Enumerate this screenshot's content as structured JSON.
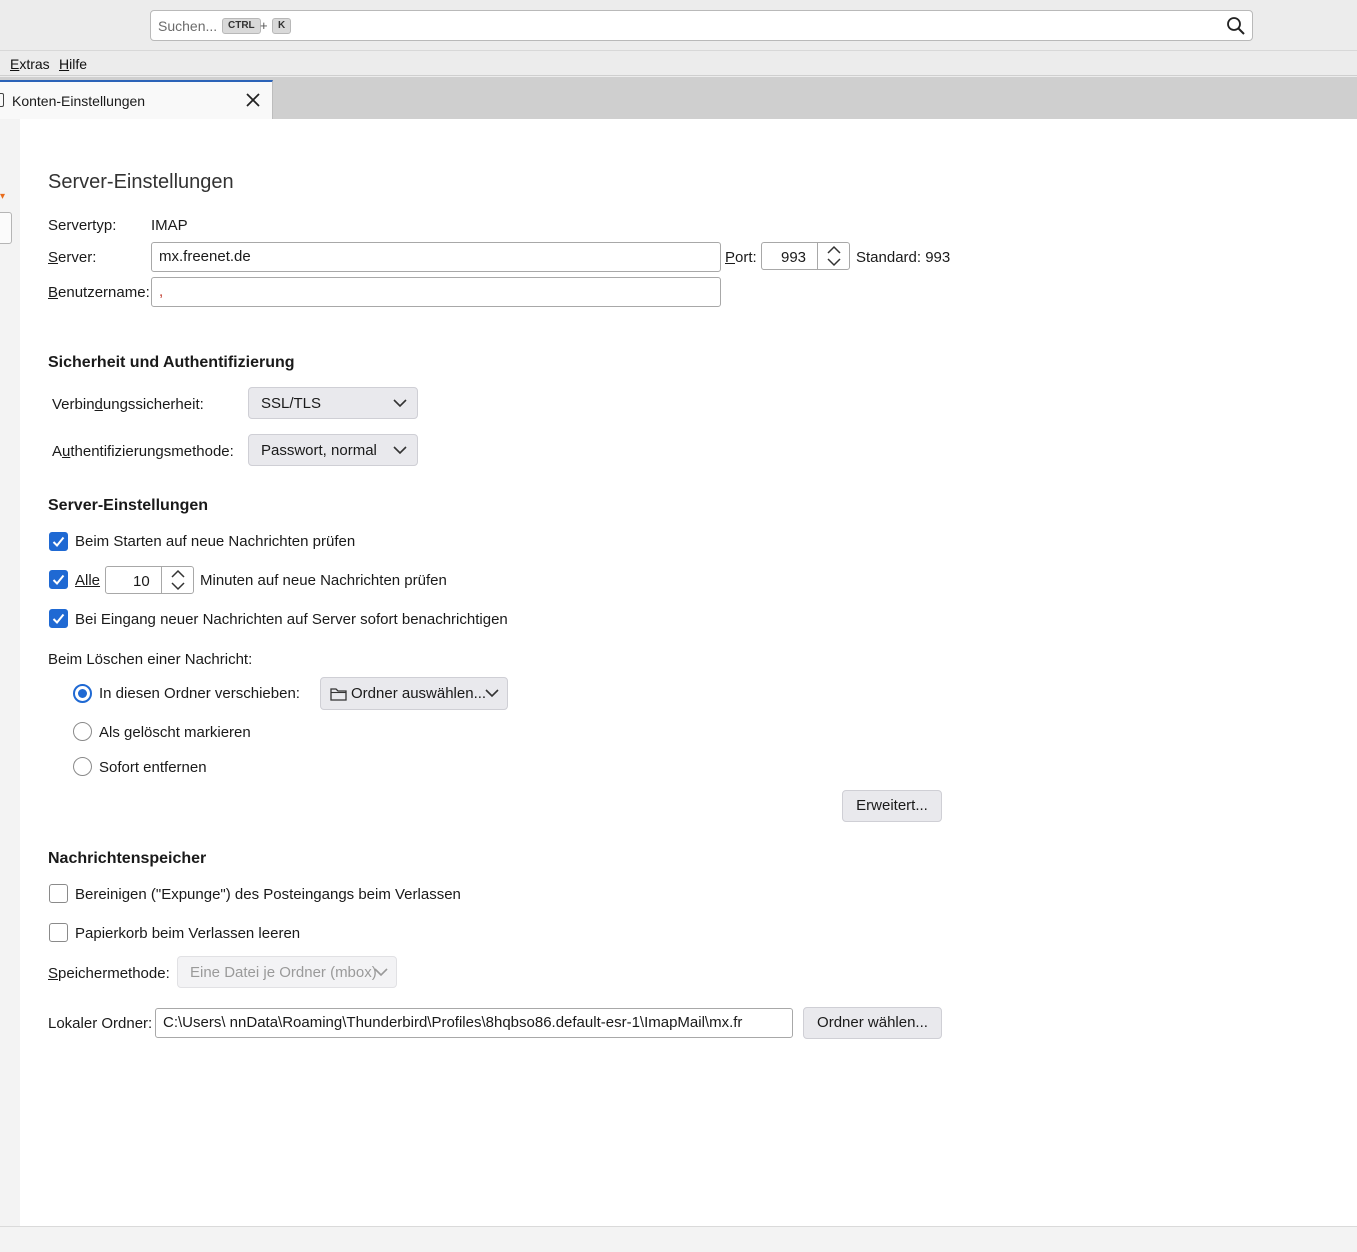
{
  "search": {
    "placeholder": "Suchen...",
    "shortcut_key1": "CTRL",
    "shortcut_plus": "+",
    "shortcut_key2": "K"
  },
  "menu": {
    "extras": "Extras",
    "hilfe": "Hilfe"
  },
  "tab": {
    "label": "Konten-Einstellungen"
  },
  "page": {
    "title": "Server-Einstellungen"
  },
  "server": {
    "type_label": "Servertyp:",
    "type_value": "IMAP",
    "server_label": "Server:",
    "server_value": "mx.freenet.de",
    "port_label": "Port:",
    "port_value": "993",
    "standard_label": "Standard: 993",
    "username_label": "Benutzername:",
    "username_value": ","
  },
  "security": {
    "heading": "Sicherheit und Authentifizierung",
    "connection_label": "Verbindungssicherheit:",
    "connection_value": "SSL/TLS",
    "auth_label": "Authentifizierungsmethode:",
    "auth_value": "Passwort, normal"
  },
  "server_settings": {
    "heading": "Server-Einstellungen",
    "check_on_start": "Beim Starten auf neue Nachrichten prüfen",
    "every_label": "Alle",
    "every_value": "10",
    "every_suffix": "Minuten auf neue Nachrichten prüfen",
    "idle_notify": "Bei Eingang neuer Nachrichten auf Server sofort benachrichtigen",
    "delete_label": "Beim Löschen einer Nachricht:",
    "move_option": "In diesen Ordner verschieben:",
    "folder_select": "Ordner auswählen...",
    "mark_deleted": "Als gelöscht markieren",
    "remove_now": "Sofort entfernen",
    "advanced_button": "Erweitert..."
  },
  "storage": {
    "heading": "Nachrichtenspeicher",
    "expunge": "Bereinigen (\"Expunge\") des Posteingangs beim Verlassen",
    "empty_trash": "Papierkorb beim Verlassen leeren",
    "method_label": "Speichermethode:",
    "method_value": "Eine Datei je Ordner (mbox)",
    "local_folder_label": "Lokaler Ordner:",
    "local_folder_value": "C:\\Users\\                   nnData\\Roaming\\Thunderbird\\Profiles\\8hqbso86.default-esr-1\\ImapMail\\mx.fr",
    "choose_folder_button": "Ordner wählen..."
  },
  "colors": {
    "accent": "#1f69d3",
    "tab_indicator": "#2b63b8"
  }
}
